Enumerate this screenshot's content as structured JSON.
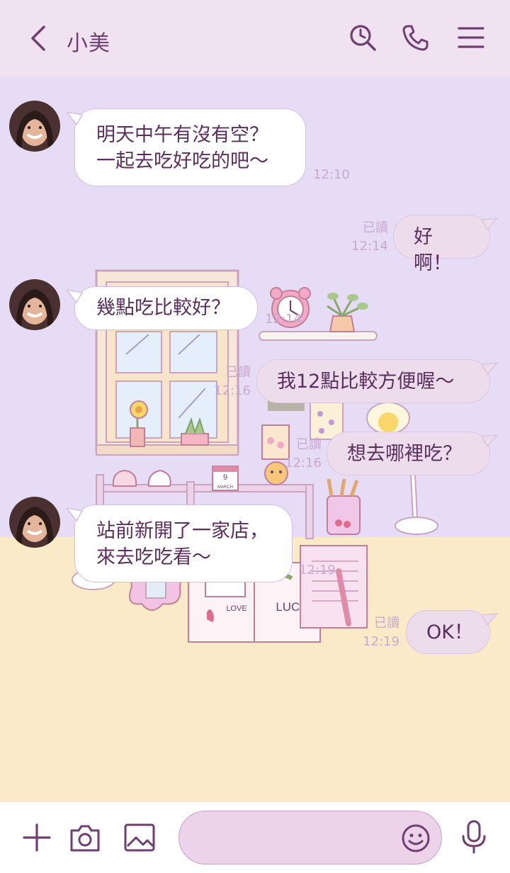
{
  "header": {
    "title": "小美"
  },
  "messages": [
    {
      "side": "in",
      "lines": [
        "明天中午有沒有空？",
        "一起去吃好吃的吧〜"
      ],
      "time": "12:10"
    },
    {
      "side": "out",
      "text": "好啊！",
      "read": "已讀",
      "time": "12:14"
    },
    {
      "side": "in",
      "lines": [
        "幾點吃比較好？"
      ],
      "time": "12:14"
    },
    {
      "side": "out",
      "text": "我12點比較方便喔〜",
      "read": "已讀",
      "time": "12:16"
    },
    {
      "side": "out",
      "text": "想去哪裡吃？",
      "read": "已讀",
      "time": "12:16"
    },
    {
      "side": "in",
      "lines": [
        "站前新開了一家店，",
        "來去吃吃看〜"
      ],
      "time": "12:19"
    },
    {
      "side": "out",
      "text": "OK！",
      "read": "已讀",
      "time": "12:19"
    }
  ],
  "decor_text": {
    "calendar_day": "9",
    "calendar_month": "MARCH",
    "book_left": "LOVE",
    "book_right": "LUCK"
  },
  "colors": {
    "header_bg": "#f1e2f2",
    "accent": "#6e3f70",
    "chat_bg": "#e7dcf6",
    "floor_bg": "#fbeac7"
  },
  "icons": [
    "back-icon",
    "search-icon",
    "phone-icon",
    "menu-icon",
    "plus-icon",
    "camera-icon",
    "image-icon",
    "emoji-icon",
    "mic-icon"
  ]
}
